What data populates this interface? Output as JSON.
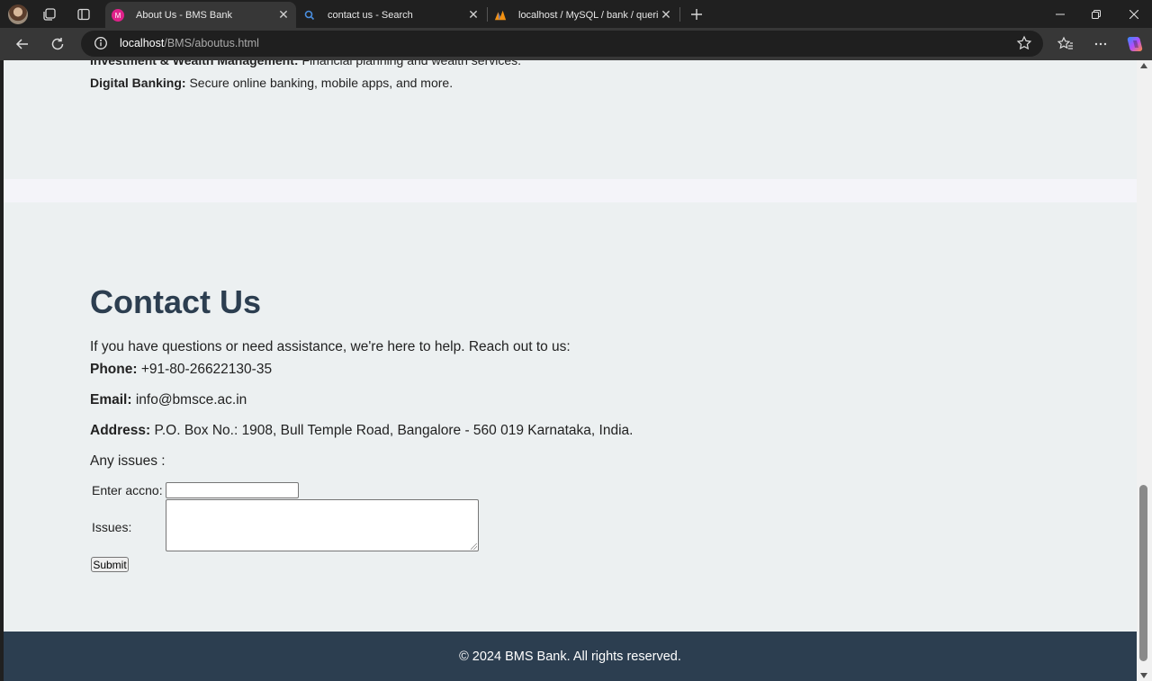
{
  "browser": {
    "tabs": [
      {
        "title": "About Us - BMS Bank",
        "active": true,
        "favicon": "site-favicon-icon"
      },
      {
        "title": "contact us - Search",
        "active": false,
        "favicon": "search-icon"
      },
      {
        "title": "localhost / MySQL / bank / querie",
        "active": false,
        "favicon": "phpmyadmin-icon"
      }
    ],
    "url_host": "localhost",
    "url_path": "/BMS/aboutus.html",
    "accent_color": "#2c3e50"
  },
  "services_tail": {
    "investment_label": "Investment & Wealth Management:",
    "investment_text": "Financial planning and wealth services.",
    "digital_label": "Digital Banking:",
    "digital_text": "Secure online banking, mobile apps, and more."
  },
  "contact": {
    "heading": "Contact Us",
    "intro": "If you have questions or need assistance, we're here to help. Reach out to us:",
    "phone_label": "Phone:",
    "phone_value": "+91-80-26622130-35",
    "email_label": "Email:",
    "email_value": "info@bmsce.ac.in",
    "address_label": "Address:",
    "address_value": "P.O. Box No.: 1908, Bull Temple Road, Bangalore - 560 019 Karnataka, India.",
    "issues_prompt": "Any issues :",
    "form": {
      "accno_label": "Enter accno:",
      "accno_value": "",
      "issues_label": "Issues:",
      "issues_value": "",
      "submit_label": "Submit"
    }
  },
  "footer": {
    "text": "© 2024 BMS Bank. All rights reserved."
  }
}
